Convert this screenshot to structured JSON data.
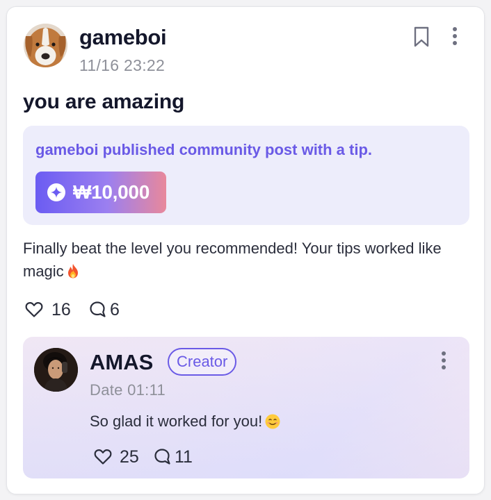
{
  "post": {
    "author": "gameboi",
    "timestamp": "11/16  23:22",
    "title": "you are amazing",
    "tip_message": "gameboi published community post with a tip.",
    "tip_amount": "₩10,000",
    "body": "Finally beat the level you recommended! Your tips worked like magic",
    "body_emoji": "fire-emoji",
    "likes": "16",
    "comments": "6"
  },
  "reply": {
    "author": "AMAS",
    "badge": "Creator",
    "date": "Date  01:11",
    "text": "So glad it worked for you!",
    "text_emoji": "smiling-face-emoji",
    "likes": "25",
    "comments": "11"
  },
  "icons": [
    "bookmark-icon",
    "more-vertical-icon",
    "coin-icon",
    "heart-icon",
    "comment-icon"
  ],
  "colors": {
    "accent": "#6a5ae6",
    "tip_box_bg": "#ededfb",
    "tip_gradient_start": "#6b5cf2",
    "tip_gradient_end": "#e8889b",
    "text_primary": "#14172b",
    "text_muted": "#8e9099"
  }
}
